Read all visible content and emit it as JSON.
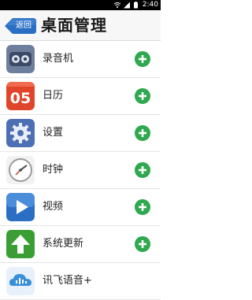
{
  "status_bar": {
    "time": "2:40",
    "icons": [
      "wifi-icon",
      "signal-icon",
      "battery-icon"
    ]
  },
  "header": {
    "back_label": "返回",
    "title": "桌面管理"
  },
  "apps": [
    {
      "name": "录音机",
      "icon": "recorder-icon"
    },
    {
      "name": "日历",
      "icon": "calendar-icon",
      "icon_text": "05"
    },
    {
      "name": "设置",
      "icon": "settings-gear-icon"
    },
    {
      "name": "时钟",
      "icon": "clock-icon"
    },
    {
      "name": "视频",
      "icon": "video-play-icon"
    },
    {
      "name": "系统更新",
      "icon": "system-update-arrow-icon"
    },
    {
      "name": "讯飞语音+",
      "icon": "voice-cloud-icon"
    }
  ],
  "colors": {
    "accent_blue": "#2a6fc4",
    "add_green": "#2fa84f",
    "calendar_red": "#e0452b",
    "update_green": "#3a9e35"
  }
}
